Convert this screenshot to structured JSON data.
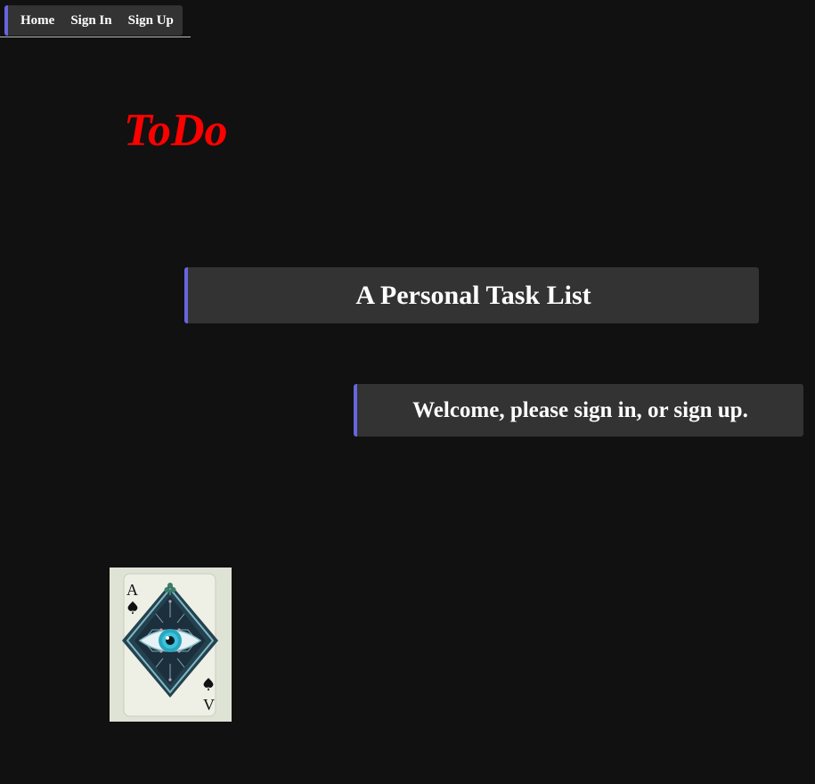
{
  "nav": {
    "items": [
      {
        "label": "Home"
      },
      {
        "label": "Sign In"
      },
      {
        "label": "Sign Up"
      }
    ]
  },
  "header": {
    "title": "ToDo"
  },
  "main": {
    "subtitle": "A Personal Task List",
    "welcome": "Welcome, please sign in, or sign up."
  },
  "image": {
    "description_icon": "ace-of-spades-eye-card",
    "corner_rank": "A",
    "corner_rank_flipped": "V"
  },
  "colors": {
    "background": "#111111",
    "panel": "#333333",
    "accent": "#6666dd",
    "title": "#ff0000",
    "text": "#ffffff"
  }
}
